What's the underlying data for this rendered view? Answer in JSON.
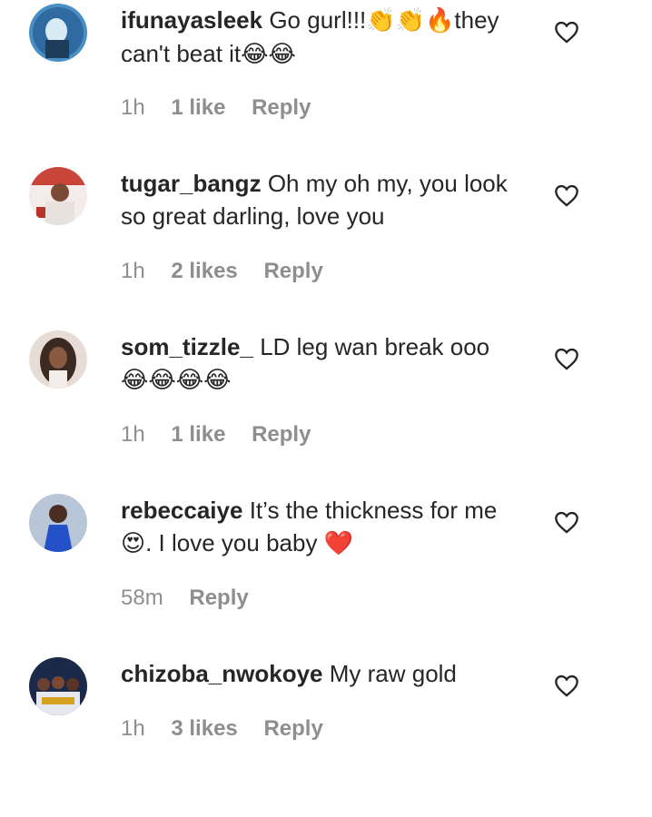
{
  "comments": [
    {
      "username": "ifunayasleek",
      "text_before": "Go gurl!!!",
      "emojis_1": "👏👏🔥",
      "text_after": "they can't beat it",
      "emojis_2": "😂😂",
      "time": "1h",
      "likes": "1 like",
      "reply": "Reply",
      "avatar_icon": "avatar-photo-blue"
    },
    {
      "username": "tugar_bangz",
      "text": "Oh my oh my, you look so great darling, love you",
      "time": "1h",
      "likes": "2 likes",
      "reply": "Reply",
      "avatar_icon": "avatar-photo-red"
    },
    {
      "username": "som_tizzle_",
      "text": "LD leg wan break ooo",
      "emojis": "😂😂😂😂",
      "time": "1h",
      "likes": "1 like",
      "reply": "Reply",
      "avatar_icon": "avatar-photo-woman"
    },
    {
      "username": "rebeccaiye",
      "text_before": "It’s the thickness for me",
      "emoji_1": "😍",
      "text_after": ". I love you baby",
      "emoji_2": "❤️",
      "time": "58m",
      "reply": "Reply",
      "avatar_icon": "avatar-photo-blue-dress"
    },
    {
      "username": "chizoba_nwokoye",
      "text": "My raw gold",
      "time": "1h",
      "likes": "3 likes",
      "reply": "Reply",
      "avatar_icon": "avatar-photo-group"
    }
  ],
  "colors": {
    "text": "#262626",
    "meta": "#8e8e8e",
    "heart_red": "#e0273b"
  },
  "icons": {
    "like": "heart-outline-icon"
  }
}
